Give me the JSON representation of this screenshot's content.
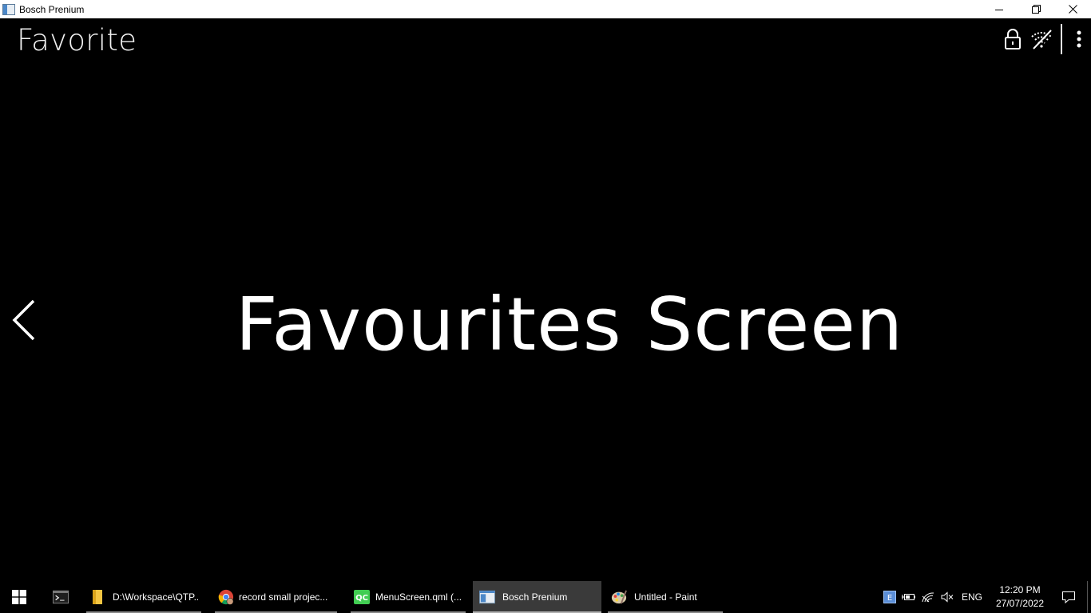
{
  "window": {
    "title": "Bosch Prenium"
  },
  "app": {
    "page_title": "Favorite",
    "main_text": "Favourites Screen",
    "top_icons": [
      "lock-icon",
      "wifi-off-icon",
      "more-vert-icon"
    ]
  },
  "taskbar": {
    "items": [
      {
        "icon": "terminal-icon",
        "label": ""
      },
      {
        "icon": "folder-icon",
        "label": "D:\\Workspace\\QTP..."
      },
      {
        "icon": "chrome-icon",
        "label": "record small projec..."
      },
      {
        "icon": "qt-creator-icon",
        "label": "MenuScreen.qml (..."
      },
      {
        "icon": "app-window-icon",
        "label": "Bosch Prenium"
      },
      {
        "icon": "paint-icon",
        "label": "Untitled - Paint"
      }
    ],
    "tray": {
      "language": "ENG",
      "time": "12:20 PM",
      "date": "27/07/2022"
    }
  }
}
